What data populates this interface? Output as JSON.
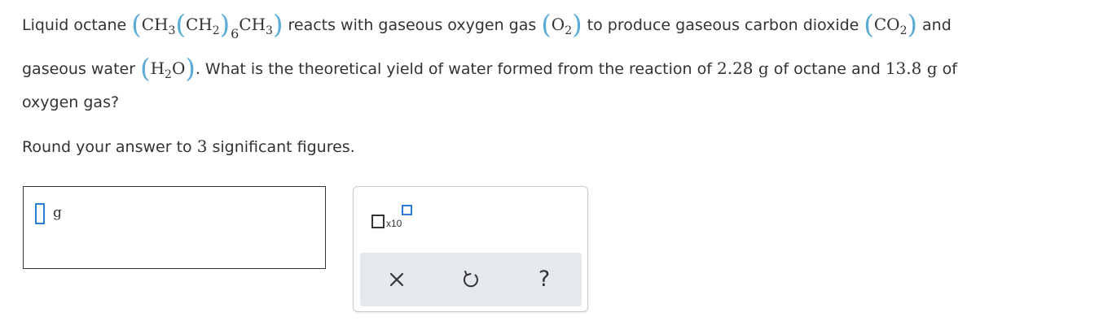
{
  "question": {
    "p1": "Liquid octane",
    "p2": "reacts with gaseous oxygen gas",
    "p3": "to produce gaseous carbon dioxide",
    "p4": "and",
    "p5": "gaseous water",
    "p6": ". What is the theoretical yield of water formed from the reaction of",
    "mass_octane": "2.28 g",
    "p7": "of octane and",
    "mass_oxygen": "13.8 g",
    "p8": "of",
    "p9": "oxygen gas?"
  },
  "formulas": {
    "octane": {
      "ch3_a": "CH",
      "sub3_a": "3",
      "ch2": "CH",
      "sub2": "2",
      "sub6": "6",
      "ch3_b": "CH",
      "sub3_b": "3"
    },
    "oxygen": {
      "o": "O",
      "sub": "2"
    },
    "co2": {
      "co": "CO",
      "sub": "2"
    },
    "water": {
      "h": "H",
      "sub": "2",
      "o": "O"
    }
  },
  "instruction": {
    "before": "Round your answer to",
    "number": "3",
    "after": "significant figures."
  },
  "answer": {
    "value": "",
    "unit": "g"
  },
  "tools": {
    "x10_label": "x10",
    "help_label": "?"
  },
  "colors": {
    "accent": "#2a7fd4",
    "paren": "#5aaad8",
    "text": "#333333",
    "tool_bar": "#e6e9ec"
  },
  "icons": {
    "clear": "close-x-icon",
    "undo": "undo-icon",
    "help": "question-mark-icon"
  }
}
